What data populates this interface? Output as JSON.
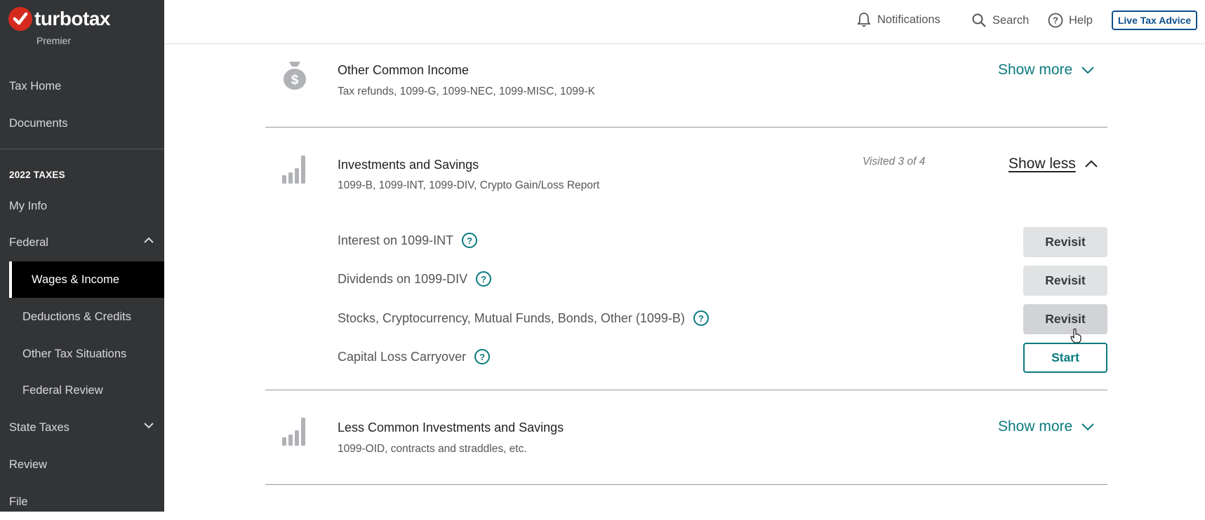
{
  "brand": {
    "name": "turbotax",
    "edition": "Premier",
    "accent_color": "#d52b1e"
  },
  "sidebar": {
    "top_items": [
      {
        "label": "Tax Home"
      },
      {
        "label": "Documents"
      }
    ],
    "section_heading": "2022 TAXES",
    "items": [
      {
        "label": "My Info"
      },
      {
        "label": "Federal",
        "expanded": true
      },
      {
        "label": "Wages & Income",
        "active": true
      },
      {
        "label": "Deductions & Credits"
      },
      {
        "label": "Other Tax Situations"
      },
      {
        "label": "Federal Review"
      },
      {
        "label": "State Taxes",
        "expanded": false
      },
      {
        "label": "Review"
      },
      {
        "label": "File"
      }
    ]
  },
  "topbar": {
    "notifications": "Notifications",
    "search": "Search",
    "help": "Help",
    "live_advice": "Live Tax Advice"
  },
  "sections": [
    {
      "icon": "money-bag-icon",
      "title": "Other Common Income",
      "subtitle": "Tax refunds, 1099-G, 1099-NEC, 1099-MISC, 1099-K",
      "toggle": "Show more"
    },
    {
      "icon": "bar-chart-icon",
      "title": "Investments and Savings",
      "subtitle": "1099-B, 1099-INT, 1099-DIV, Crypto Gain/Loss Report",
      "visited": "Visited 3 of 4",
      "toggle": "Show less",
      "rows": [
        {
          "label": "Interest on 1099-INT",
          "action": "Revisit"
        },
        {
          "label": "Dividends on 1099-DIV",
          "action": "Revisit"
        },
        {
          "label": "Stocks, Cryptocurrency, Mutual Funds, Bonds, Other (1099-B)",
          "action": "Revisit"
        },
        {
          "label": "Capital Loss Carryover",
          "action": "Start"
        }
      ]
    },
    {
      "icon": "bar-chart-icon",
      "title": "Less Common Investments and Savings",
      "subtitle": "1099-OID, contracts and straddles, etc.",
      "toggle": "Show more"
    }
  ],
  "colors": {
    "teal": "#0a7a7e",
    "sidebar_bg": "#333436",
    "live_advice_blue": "#0d4f8b"
  }
}
